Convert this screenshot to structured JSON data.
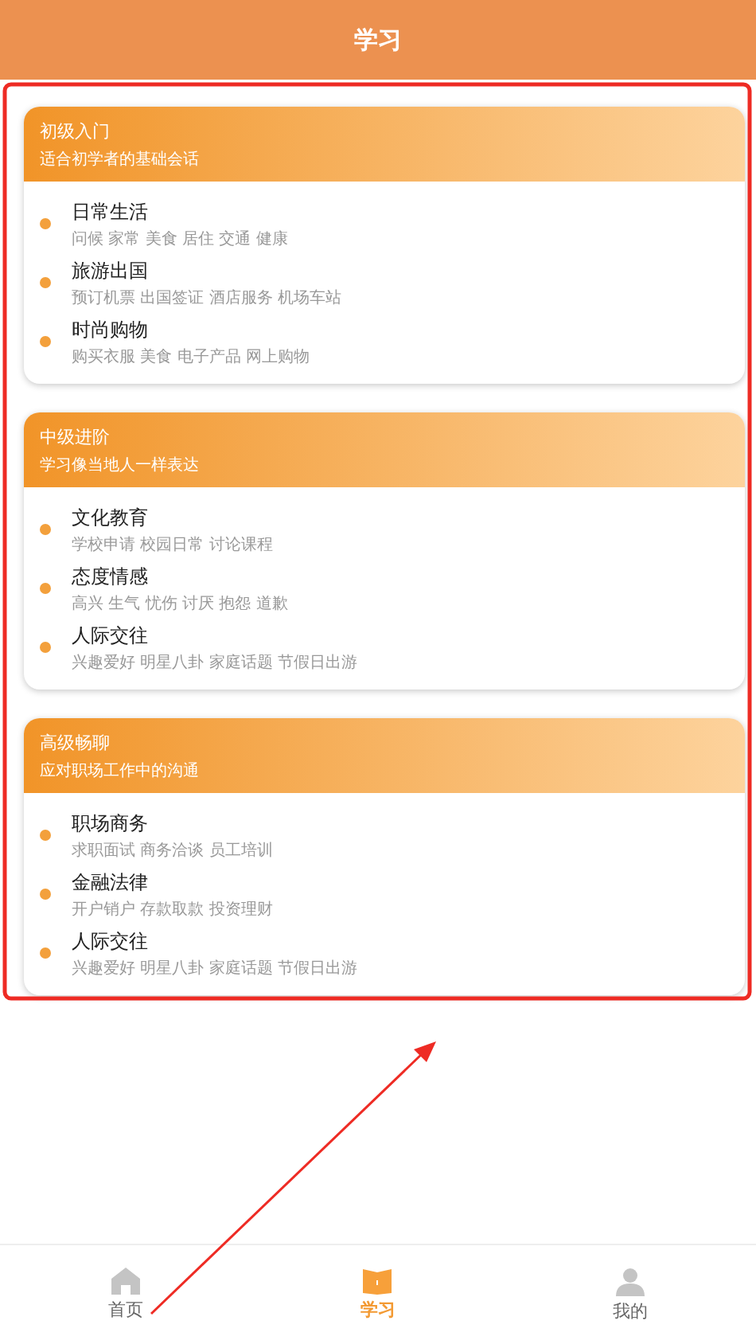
{
  "header": {
    "title": "学习"
  },
  "sections": [
    {
      "title": "初级入门",
      "subtitle": "适合初学者的基础会话",
      "topics": [
        {
          "name": "日常生活",
          "tags": "问候 家常 美食 居住 交通 健康"
        },
        {
          "name": "旅游出国",
          "tags": "预订机票 出国签证 酒店服务 机场车站"
        },
        {
          "name": "时尚购物",
          "tags": "购买衣服 美食 电子产品 网上购物"
        }
      ]
    },
    {
      "title": "中级进阶",
      "subtitle": "学习像当地人一样表达",
      "topics": [
        {
          "name": "文化教育",
          "tags": "学校申请 校园日常 讨论课程"
        },
        {
          "name": "态度情感",
          "tags": "高兴 生气 忧伤 讨厌 抱怨 道歉"
        },
        {
          "name": "人际交往",
          "tags": "兴趣爱好 明星八卦 家庭话题 节假日出游"
        }
      ]
    },
    {
      "title": "高级畅聊",
      "subtitle": "应对职场工作中的沟通",
      "topics": [
        {
          "name": "职场商务",
          "tags": "求职面试 商务洽谈 员工培训"
        },
        {
          "name": "金融法律",
          "tags": "开户销户 存款取款 投资理财"
        },
        {
          "name": "人际交往",
          "tags": "兴趣爱好 明星八卦 家庭话题 节假日出游"
        }
      ]
    }
  ],
  "tab_bar": [
    {
      "label": "首页",
      "kind": "home",
      "selected": false
    },
    {
      "label": "学习",
      "kind": "book",
      "selected": true
    },
    {
      "label": "我的",
      "kind": "person",
      "selected": false
    }
  ]
}
